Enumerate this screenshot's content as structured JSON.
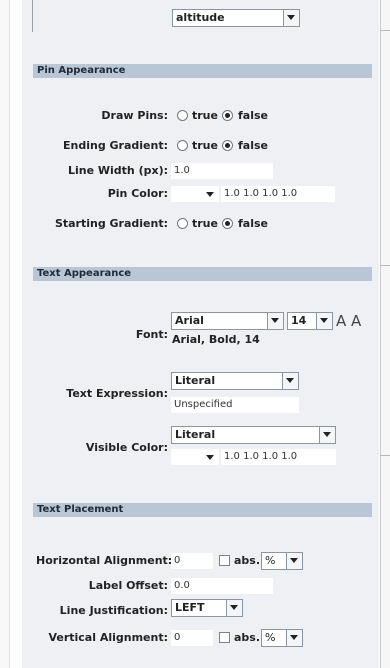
{
  "altitude_combo": {
    "value": "altitude"
  },
  "pin_appearance": {
    "header": "Pin Appearance",
    "draw_pins": {
      "label": "Draw Pins:",
      "true_label": "true",
      "false_label": "false",
      "selected": "false"
    },
    "ending_gradient": {
      "label": "Ending Gradient:",
      "true_label": "true",
      "false_label": "false",
      "selected": "false"
    },
    "line_width": {
      "label": "Line Width (px):",
      "value": "1.0"
    },
    "pin_color": {
      "label": "Pin Color:",
      "value": "1.0 1.0 1.0 1.0"
    },
    "starting_gradient": {
      "label": "Starting Gradient:",
      "true_label": "true",
      "false_label": "false",
      "selected": "false"
    }
  },
  "text_appearance": {
    "header": "Text Appearance",
    "font": {
      "label": "Font:",
      "family": "Arial",
      "size": "14",
      "summary": "Arial, Bold, 14",
      "preview": "A A"
    },
    "text_expression": {
      "label": "Text Expression:",
      "mode": "Literal",
      "value": "Unspecified"
    },
    "visible_color": {
      "label": "Visible Color:",
      "mode": "Literal",
      "value": "1.0 1.0 1.0 1.0"
    }
  },
  "text_placement": {
    "header": "Text Placement",
    "horizontal_alignment": {
      "label": "Horizontal Alignment:",
      "value": "0",
      "abs_label": "abs.",
      "unit": "%"
    },
    "label_offset": {
      "label": "Label Offset:",
      "value": "0.0"
    },
    "line_justification": {
      "label": "Line Justification:",
      "value": "LEFT"
    },
    "vertical_alignment": {
      "label": "Vertical Alignment:",
      "value": "0",
      "abs_label": "abs.",
      "unit": "%"
    }
  },
  "colors": {
    "section_header": "#b9c6d6",
    "panel_bg": "#eef0f4"
  }
}
